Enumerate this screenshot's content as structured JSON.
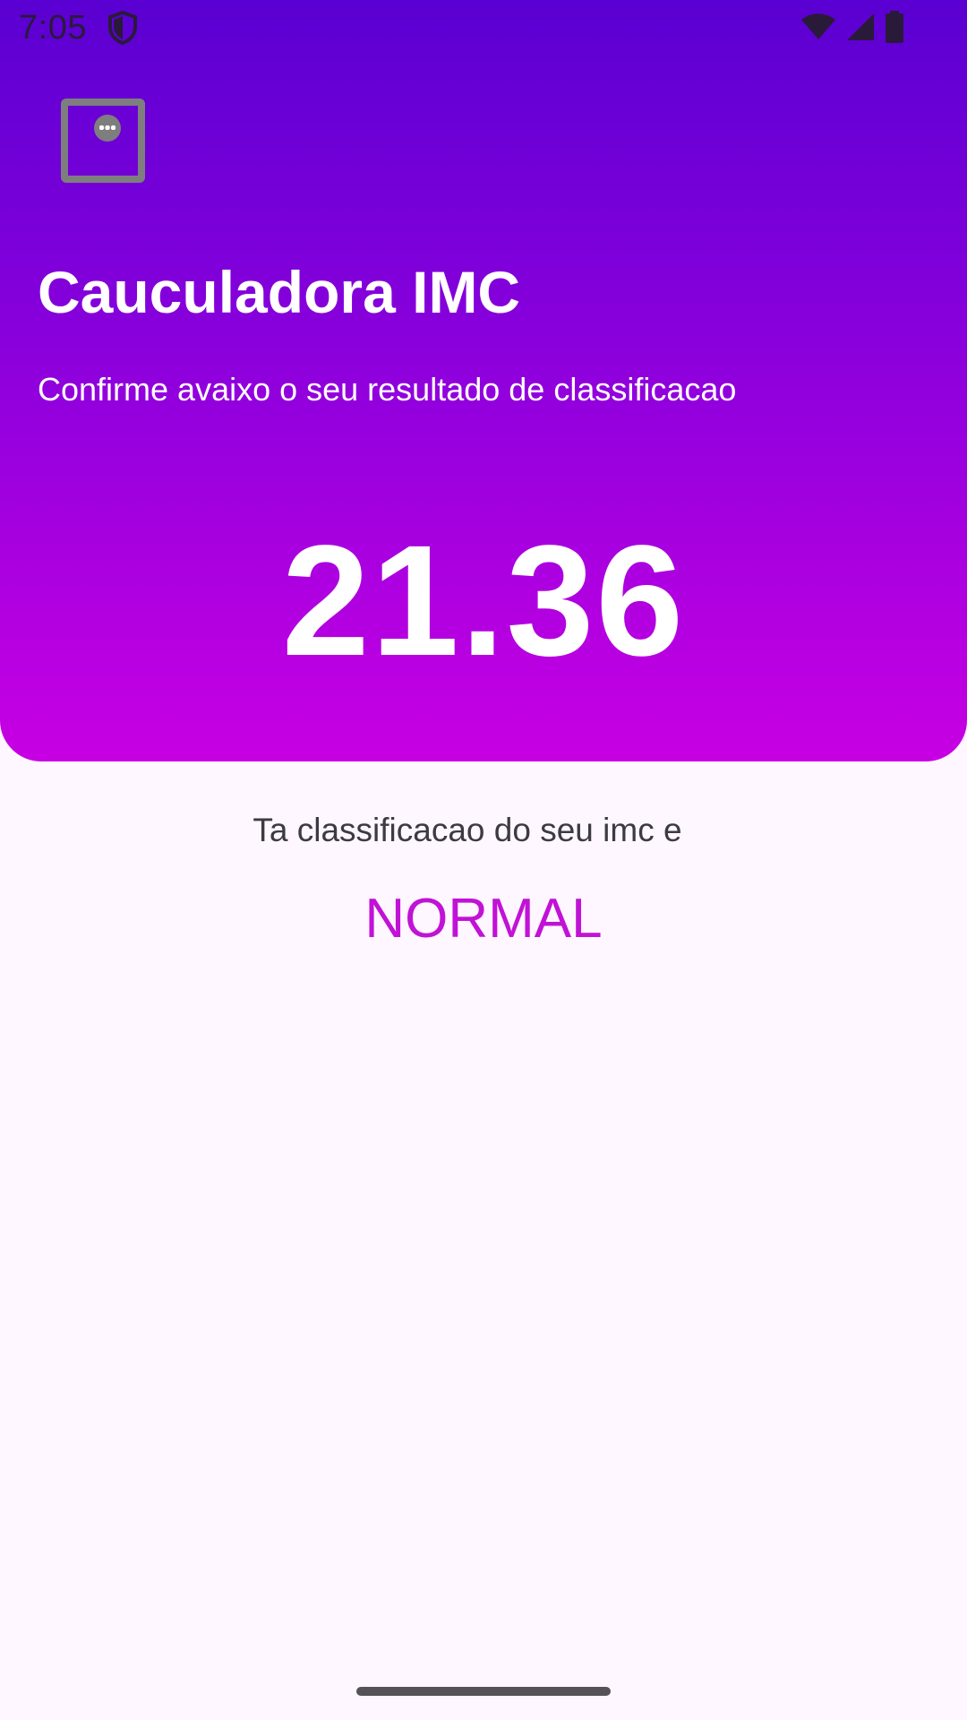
{
  "status_bar": {
    "time": "7:05",
    "icons": [
      "shield-icon",
      "wifi-icon",
      "cellular-signal-icon",
      "battery-icon"
    ]
  },
  "header": {
    "back_icon": "chat-box-icon",
    "title": "Cauculadora IMC",
    "subtitle": "Confirme avaixo o seu resultado de classificacao",
    "imc_value": "21.36",
    "gradient_colors": [
      "#5a00d2",
      "#8a00dc",
      "#c700e3"
    ]
  },
  "result": {
    "label": "Ta classificacao do seu imc e",
    "classification": "NORMAL",
    "classification_color": "#c112d6"
  }
}
